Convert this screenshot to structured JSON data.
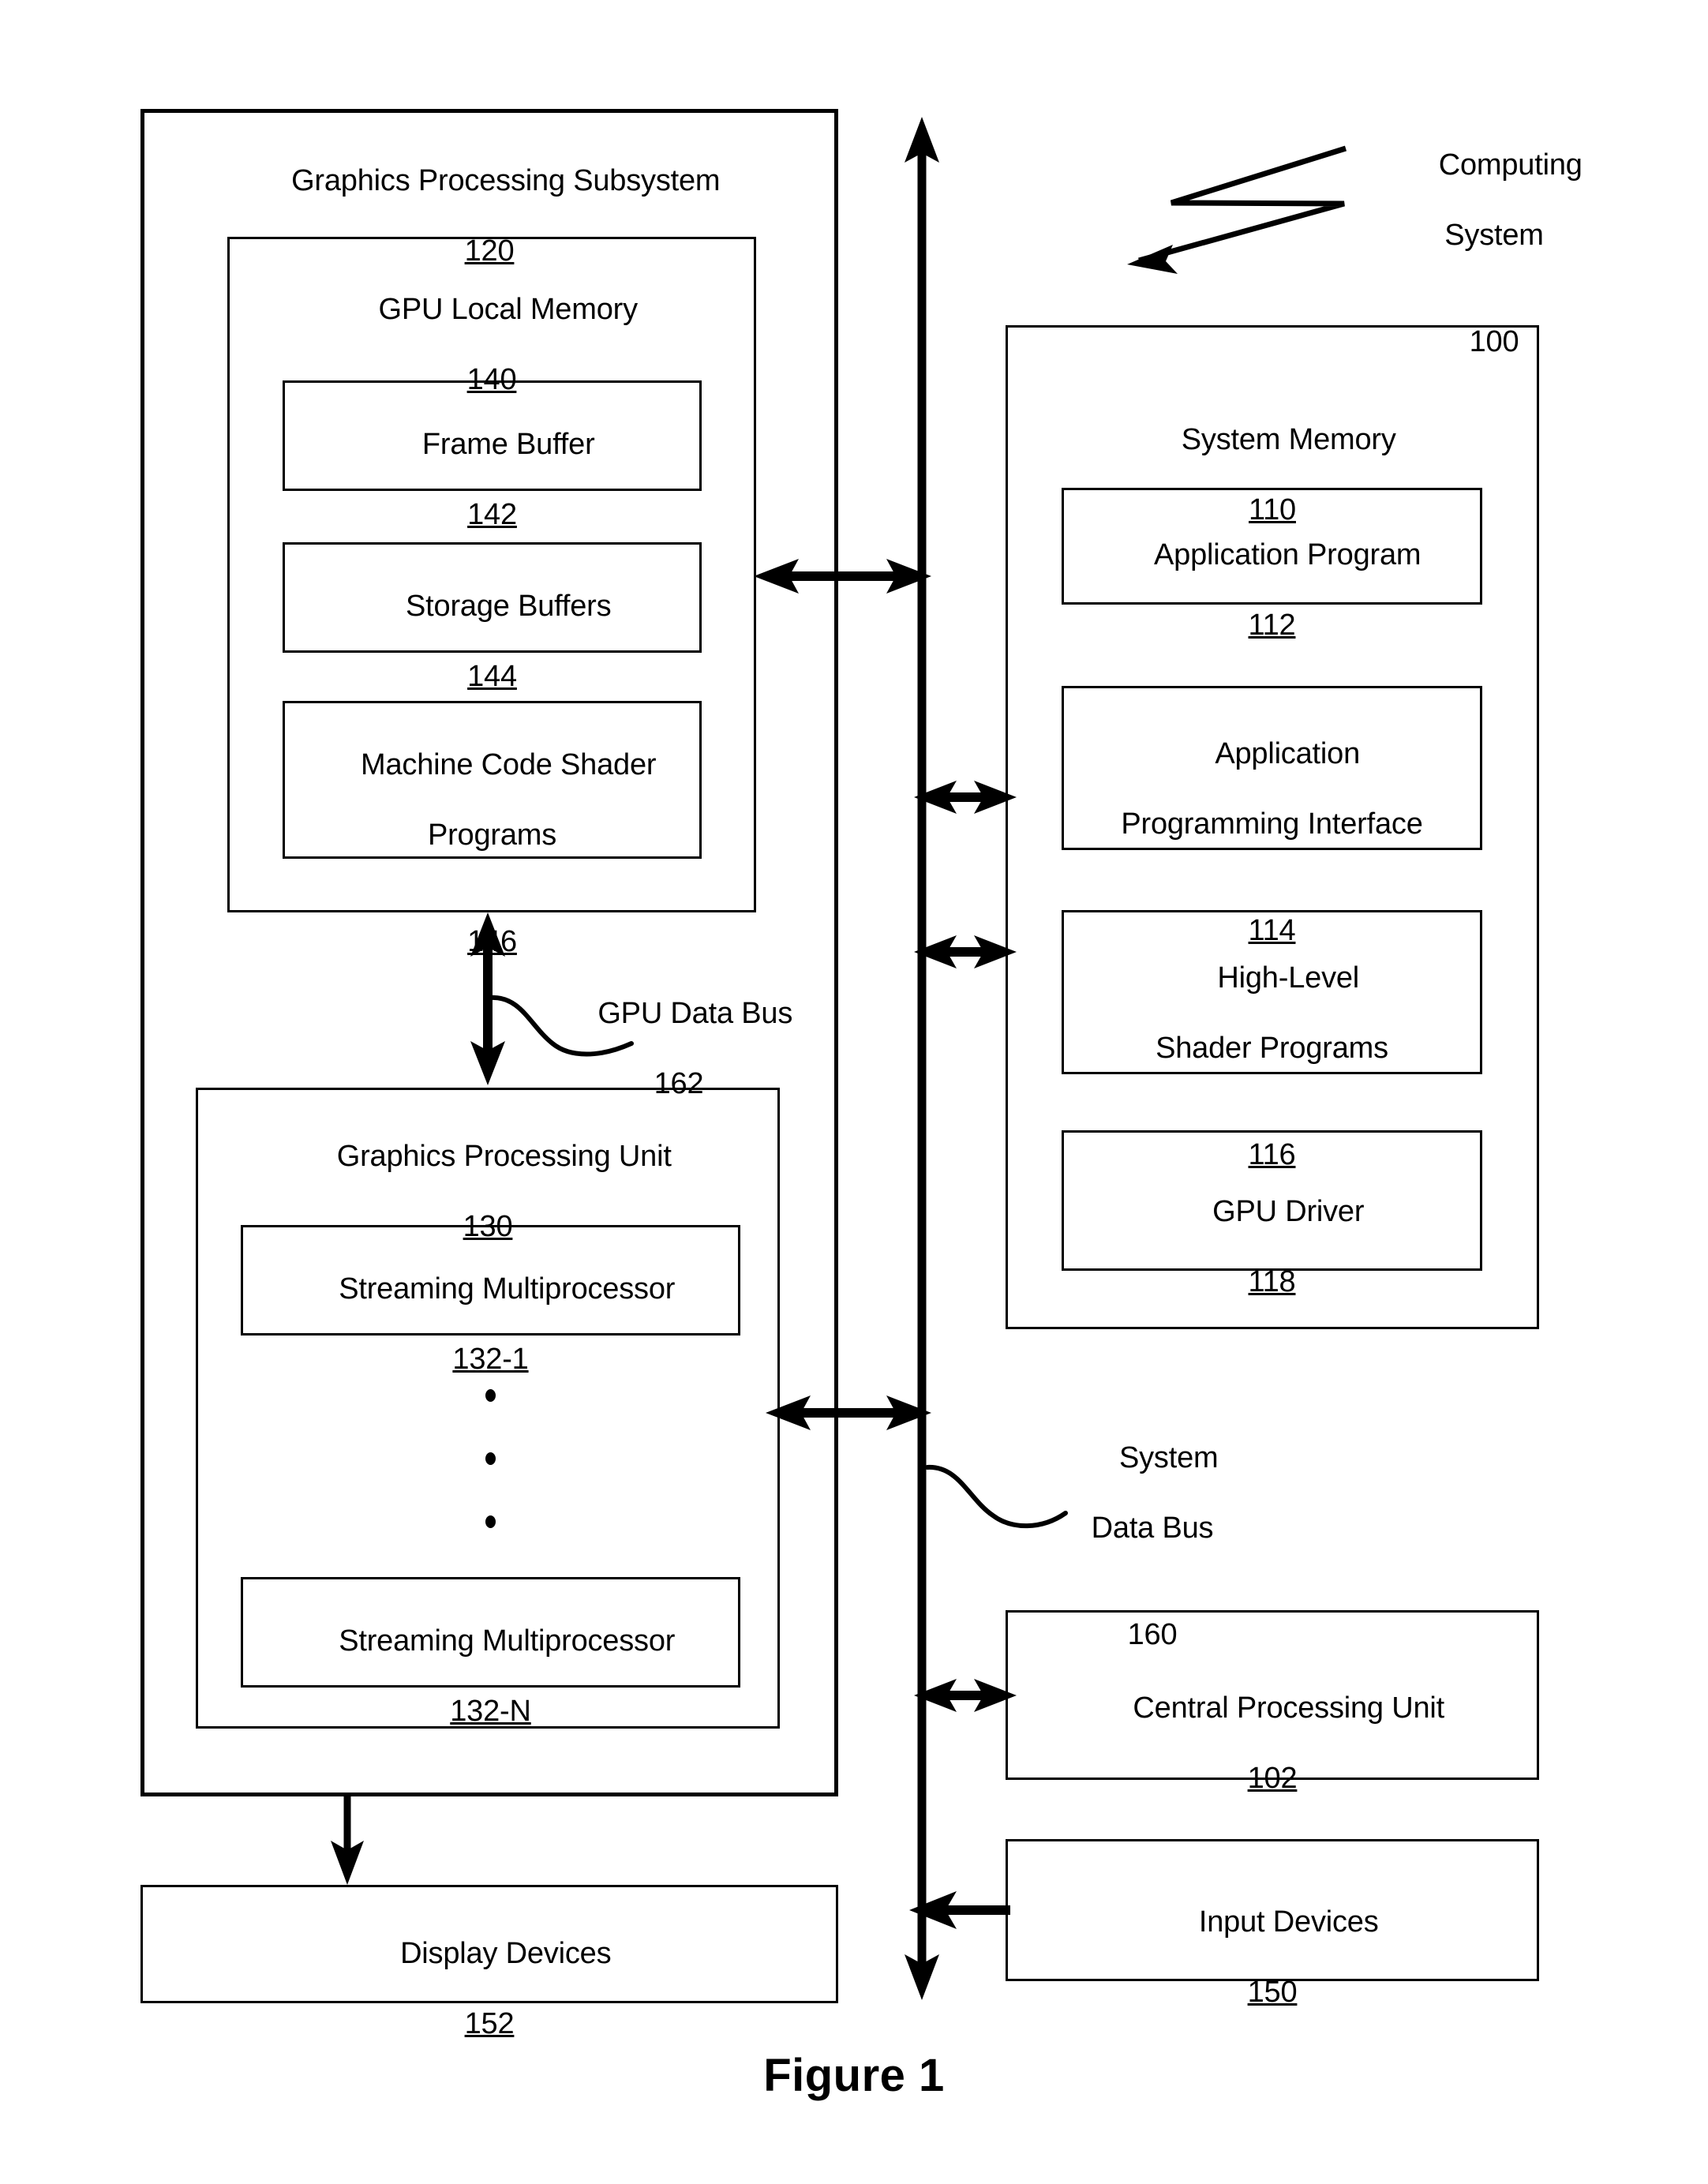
{
  "figure": {
    "caption": "Figure 1"
  },
  "callout": {
    "computing_system": {
      "line1": "Computing",
      "line2": "System",
      "number": "100"
    },
    "gpu_data_bus": {
      "line1": "GPU Data Bus",
      "number": "162"
    },
    "system_data_bus": {
      "line1": "System",
      "line2": "Data Bus",
      "number": "160"
    }
  },
  "blocks": {
    "graphics_processing_subsystem": {
      "title": "Graphics Processing Subsystem",
      "number": "120"
    },
    "gpu_local_memory": {
      "title": "GPU Local Memory",
      "number": "140"
    },
    "frame_buffer": {
      "title": "Frame Buffer",
      "number": "142"
    },
    "storage_buffers": {
      "title": "Storage Buffers",
      "number": "144"
    },
    "machine_code_shader_programs": {
      "title_line1": "Machine Code Shader",
      "title_line2": "Programs",
      "number": "146"
    },
    "graphics_processing_unit": {
      "title": "Graphics Processing Unit",
      "number": "130"
    },
    "streaming_multiprocessor_1": {
      "title": "Streaming Multiprocessor",
      "number": "132-1"
    },
    "streaming_multiprocessor_n": {
      "title": "Streaming Multiprocessor",
      "number": "132-N"
    },
    "display_devices": {
      "title": "Display Devices",
      "number": "152"
    },
    "system_memory": {
      "title": "System Memory",
      "number": "110"
    },
    "application_program": {
      "title": "Application Program",
      "number": "112"
    },
    "application_programming_interface": {
      "title_line1": "Application",
      "title_line2": "Programming Interface",
      "number": "114"
    },
    "high_level_shader_programs": {
      "title_line1": "High-Level",
      "title_line2": "Shader Programs",
      "number": "116"
    },
    "gpu_driver": {
      "title": "GPU Driver",
      "number": "118"
    },
    "central_processing_unit": {
      "title": "Central Processing Unit",
      "number": "102"
    },
    "input_devices": {
      "title": "Input Devices",
      "number": "150"
    }
  },
  "colors": {
    "stroke": "#000000",
    "background": "#ffffff"
  }
}
